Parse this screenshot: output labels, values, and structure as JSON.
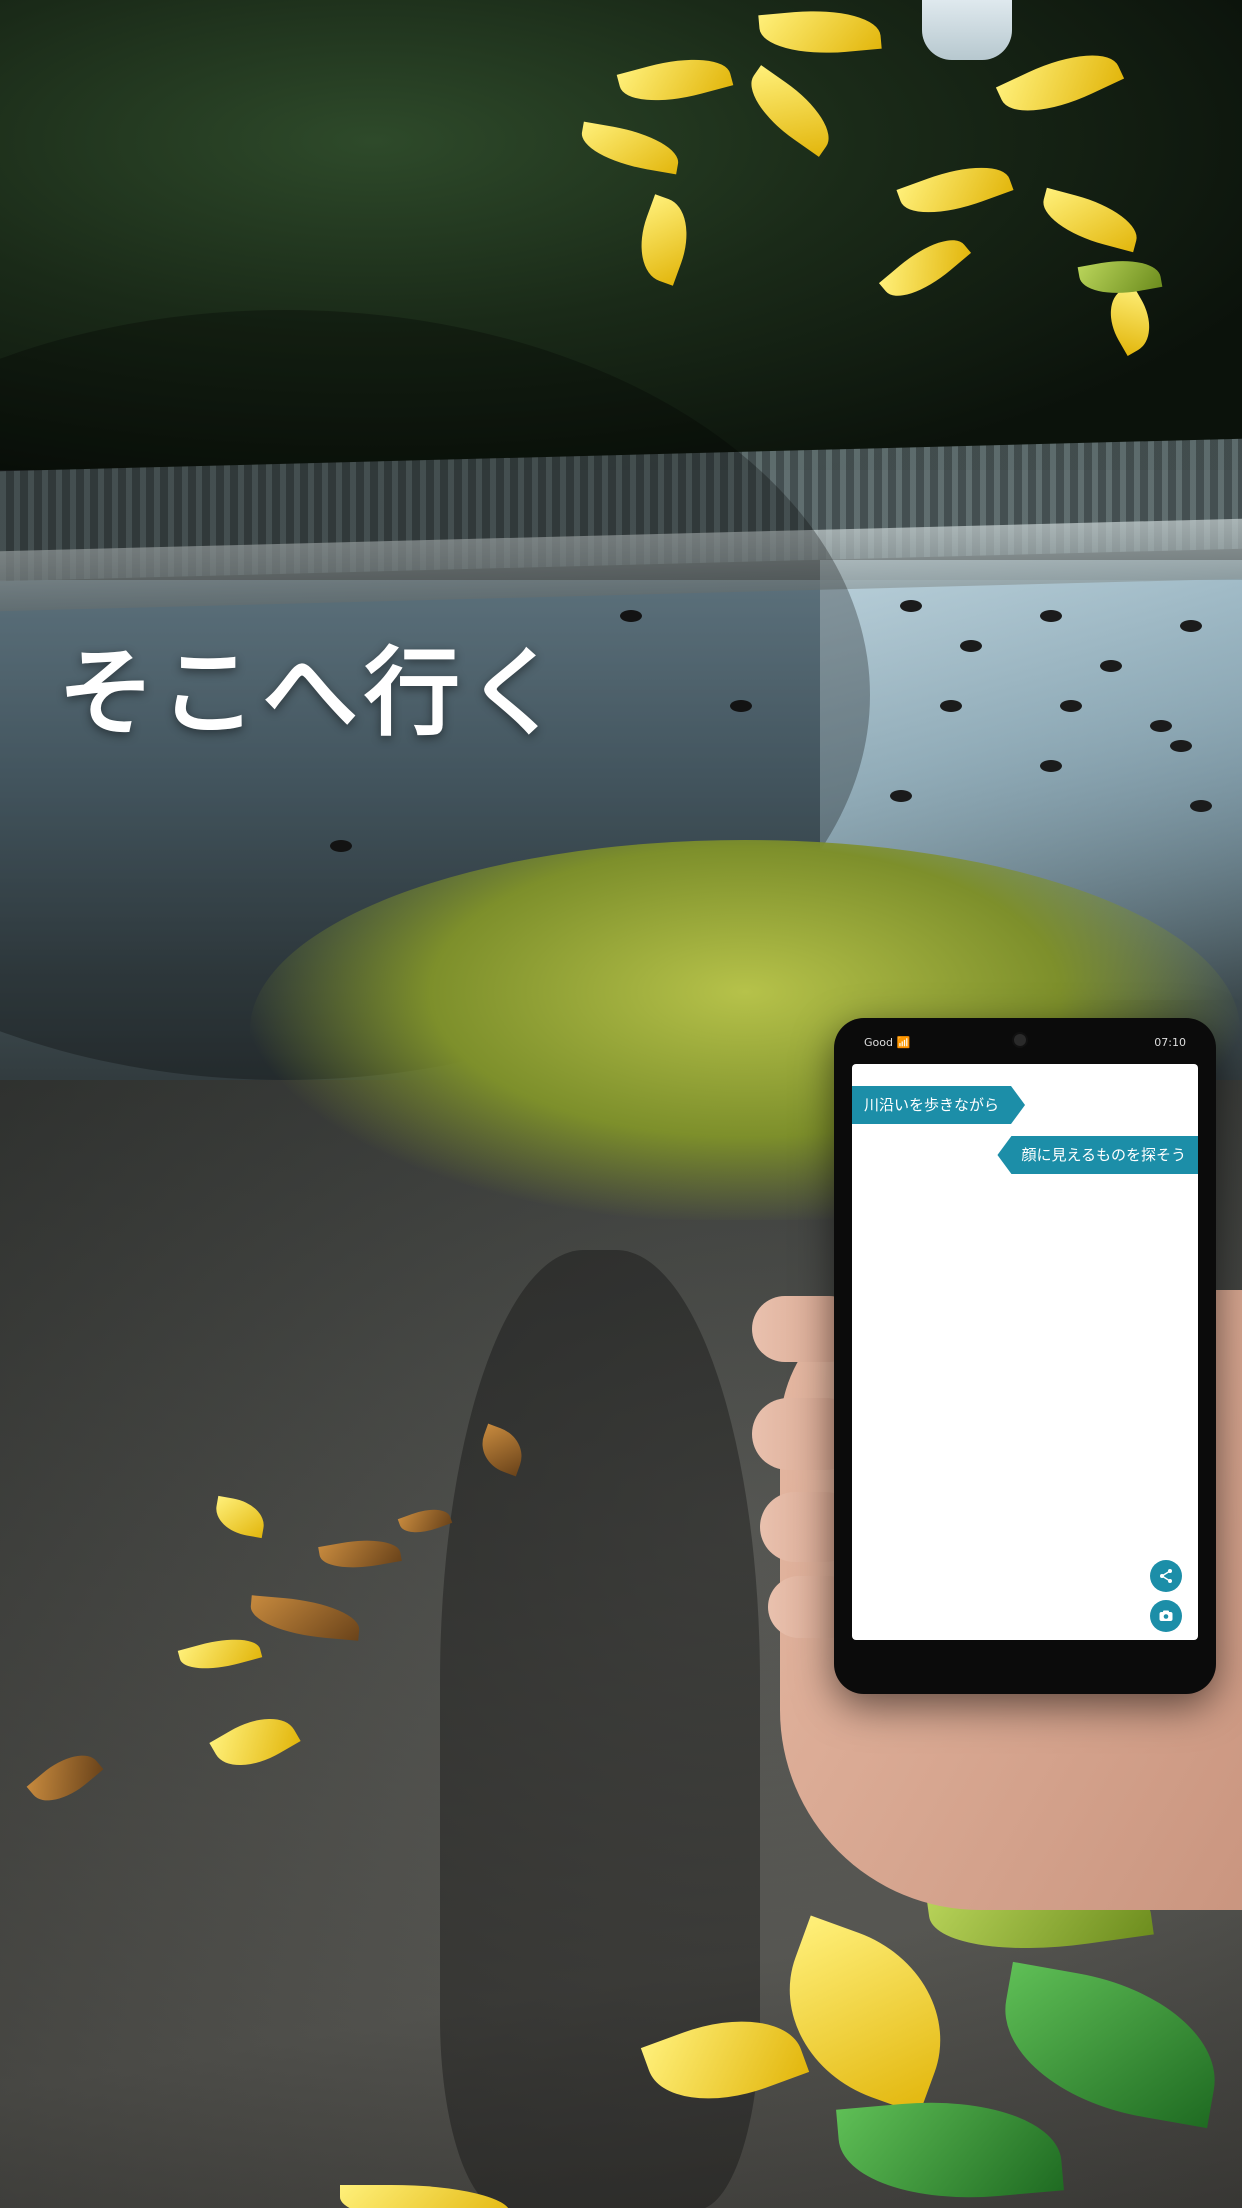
{
  "headline": "そこへ行く",
  "phone": {
    "status_left": "Good 📶",
    "status_right": "07:10",
    "messages": [
      {
        "text": "川沿いを歩きながら",
        "side": "left"
      },
      {
        "text": "顔に見えるものを探そう",
        "side": "right"
      }
    ],
    "buttons": [
      {
        "icon": "share-icon"
      },
      {
        "icon": "camera-icon"
      }
    ],
    "accent_color": "#1c8ea8"
  }
}
